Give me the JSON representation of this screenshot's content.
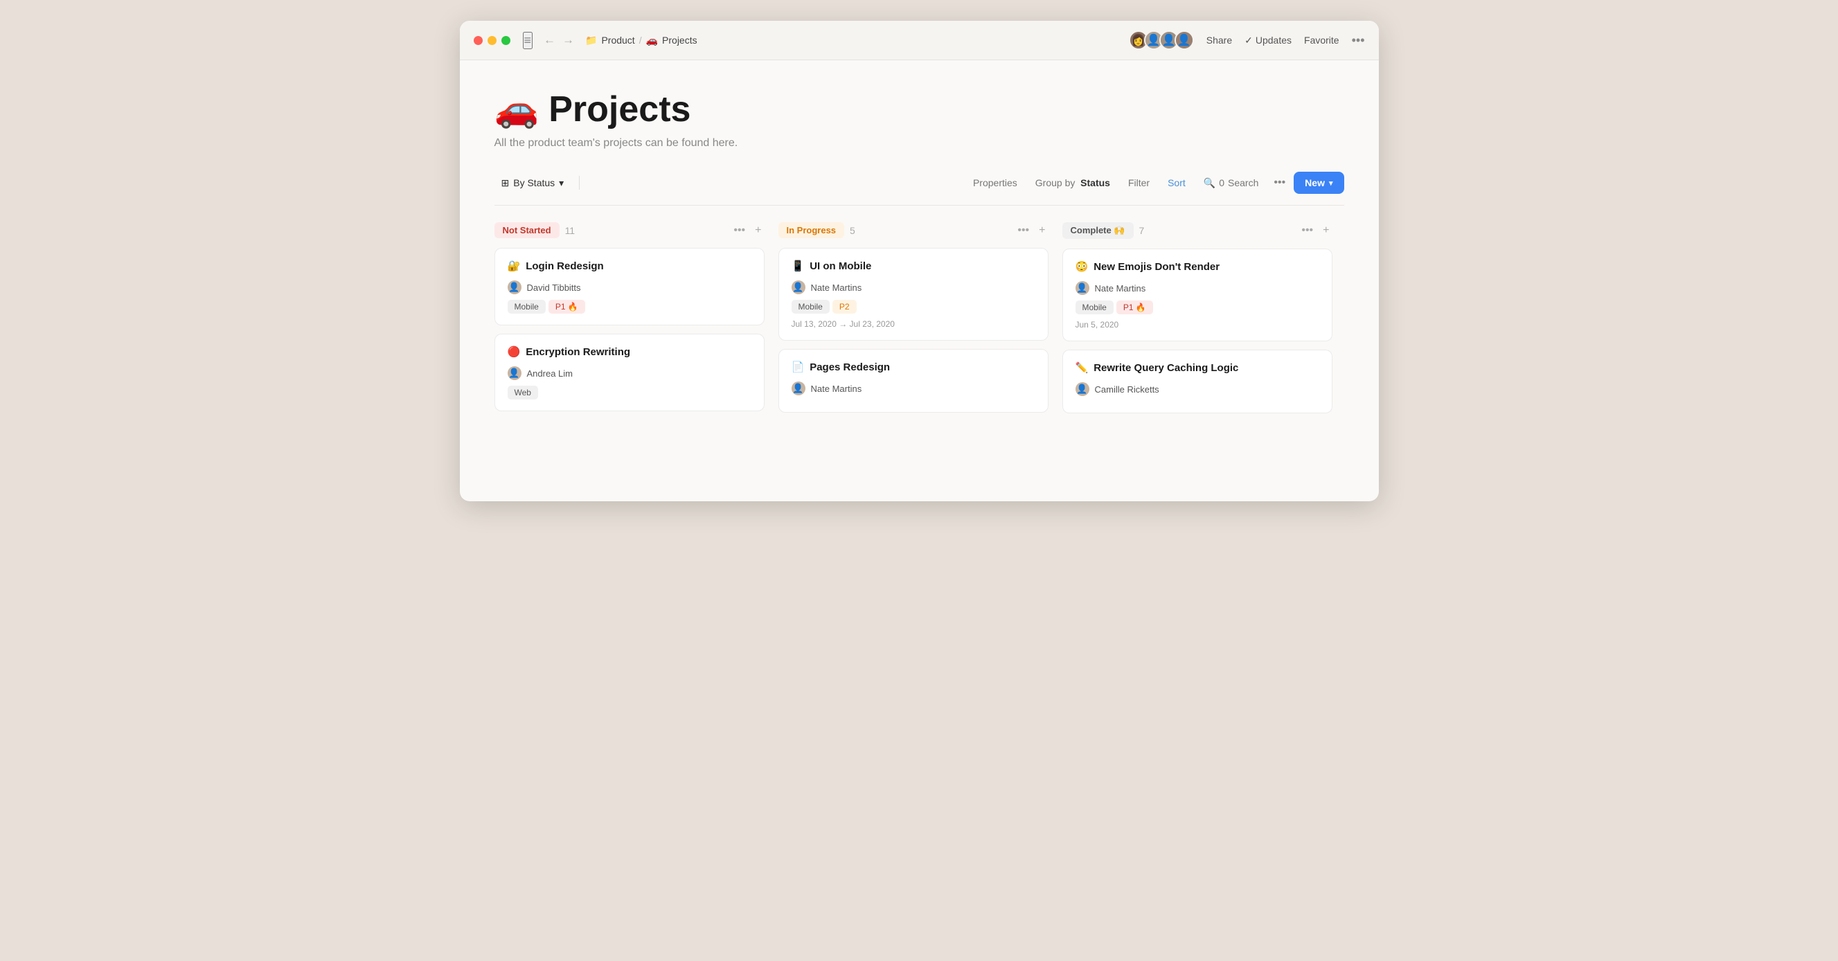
{
  "window": {
    "title": "Projects"
  },
  "titlebar": {
    "traffic_lights": [
      "red",
      "yellow",
      "green"
    ],
    "breadcrumb": [
      {
        "icon": "📁",
        "label": "Product"
      },
      {
        "icon": "🚗",
        "label": "Projects"
      }
    ],
    "back_label": "←",
    "forward_label": "→",
    "share_label": "Share",
    "updates_label": "Updates",
    "favorite_label": "Favorite",
    "more_label": "•••"
  },
  "page": {
    "icon": "🚗",
    "title": "Projects",
    "subtitle": "All the product team's projects can be found here."
  },
  "toolbar": {
    "view_label": "By Status",
    "properties_label": "Properties",
    "group_by_prefix": "Group by",
    "group_by_value": "Status",
    "filter_label": "Filter",
    "sort_label": "Sort",
    "search_label": "Search",
    "search_count": "0",
    "more_label": "•••",
    "new_label": "New"
  },
  "columns": [
    {
      "id": "not-started",
      "badge": "Not Started",
      "badge_class": "badge-not-started",
      "count": "11",
      "cards": [
        {
          "icon": "🔐",
          "title": "Login Redesign",
          "person_icon": "👤",
          "person": "David Tibbitts",
          "tags": [
            {
              "label": "Mobile",
              "class": ""
            },
            {
              "label": "P1 🔥",
              "class": "tag-p1"
            }
          ],
          "date": ""
        },
        {
          "icon": "🔴",
          "title": "Encryption Rewriting",
          "person_icon": "👤",
          "person": "Andrea Lim",
          "tags": [
            {
              "label": "Web",
              "class": ""
            }
          ],
          "date": ""
        }
      ]
    },
    {
      "id": "in-progress",
      "badge": "In Progress",
      "badge_class": "badge-in-progress",
      "count": "5",
      "cards": [
        {
          "icon": "📱",
          "title": "UI on Mobile",
          "person_icon": "👤",
          "person": "Nate Martins",
          "tags": [
            {
              "label": "Mobile",
              "class": ""
            },
            {
              "label": "P2",
              "class": "tag-p2"
            }
          ],
          "date": "Jul 13, 2020 → Jul 23, 2020"
        },
        {
          "icon": "📄",
          "title": "Pages Redesign",
          "person_icon": "👤",
          "person": "Nate Martins",
          "tags": [],
          "date": ""
        }
      ]
    },
    {
      "id": "complete",
      "badge": "Complete 🙌",
      "badge_class": "badge-complete",
      "count": "7",
      "cards": [
        {
          "icon": "😳",
          "title": "New Emojis Don't Render",
          "person_icon": "👤",
          "person": "Nate Martins",
          "tags": [
            {
              "label": "Mobile",
              "class": ""
            },
            {
              "label": "P1 🔥",
              "class": "tag-p1"
            }
          ],
          "date": "Jun 5, 2020",
          "has_more": false
        },
        {
          "icon": "✏️",
          "title": "Rewrite Query Caching Logic",
          "person_icon": "👤",
          "person": "Camille Ricketts",
          "tags": [],
          "date": "",
          "has_more": true
        }
      ]
    }
  ]
}
